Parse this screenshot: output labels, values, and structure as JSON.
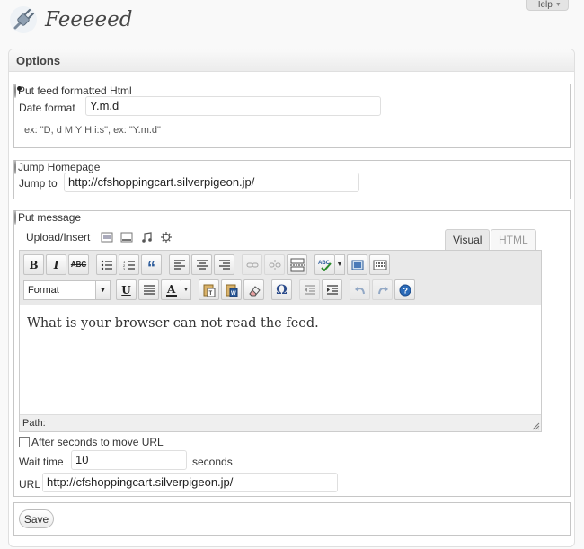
{
  "help": {
    "label": "Help"
  },
  "page": {
    "title": "Feeeeed"
  },
  "options": {
    "title": "Options",
    "formatted_html": {
      "legend": "Put feed formatted Html",
      "selected": true,
      "date_format_label": "Date format",
      "date_format_value": "Y.m.d",
      "hint": "ex: \"D, d M Y H:i:s\", ex: \"Y.m.d\""
    },
    "jump": {
      "legend": "Jump Homepage",
      "selected": false,
      "jump_to_label": "Jump to",
      "jump_to_value": "http://cfshoppingcart.silverpigeon.jp/"
    },
    "message": {
      "legend": "Put message",
      "selected": false,
      "upload_insert_label": "Upload/Insert",
      "media_icons": [
        "add-image-icon",
        "add-video-icon",
        "add-audio-icon",
        "add-media-icon"
      ],
      "tabs": {
        "visual": "Visual",
        "html": "HTML"
      },
      "active_tab": "Visual",
      "format_select": "Format",
      "toolbar_row1": [
        "bold-icon",
        "italic-icon",
        "strikethrough-icon",
        "bullet-list-icon",
        "numbered-list-icon",
        "blockquote-icon",
        "align-left-icon",
        "align-center-icon",
        "align-right-icon",
        "link-icon",
        "unlink-icon",
        "more-tag-icon",
        "spellcheck-icon",
        "fullscreen-icon",
        "kitchen-sink-icon"
      ],
      "toolbar_row2": [
        "underline-icon",
        "justify-icon",
        "text-color-icon",
        "paste-text-icon",
        "paste-word-icon",
        "remove-format-icon",
        "special-char-icon",
        "outdent-icon",
        "indent-icon",
        "undo-icon",
        "redo-icon",
        "help-icon"
      ],
      "content": "What is your browser can not read the feed.",
      "path_label": "Path:",
      "after_seconds_label": "After seconds to move URL",
      "after_seconds_checked": false,
      "wait_time_label": "Wait time",
      "wait_time_value": "10",
      "seconds_label": "seconds",
      "url_label": "URL",
      "url_value": "http://cfshoppingcart.silverpigeon.jp/"
    },
    "save_label": "Save"
  }
}
